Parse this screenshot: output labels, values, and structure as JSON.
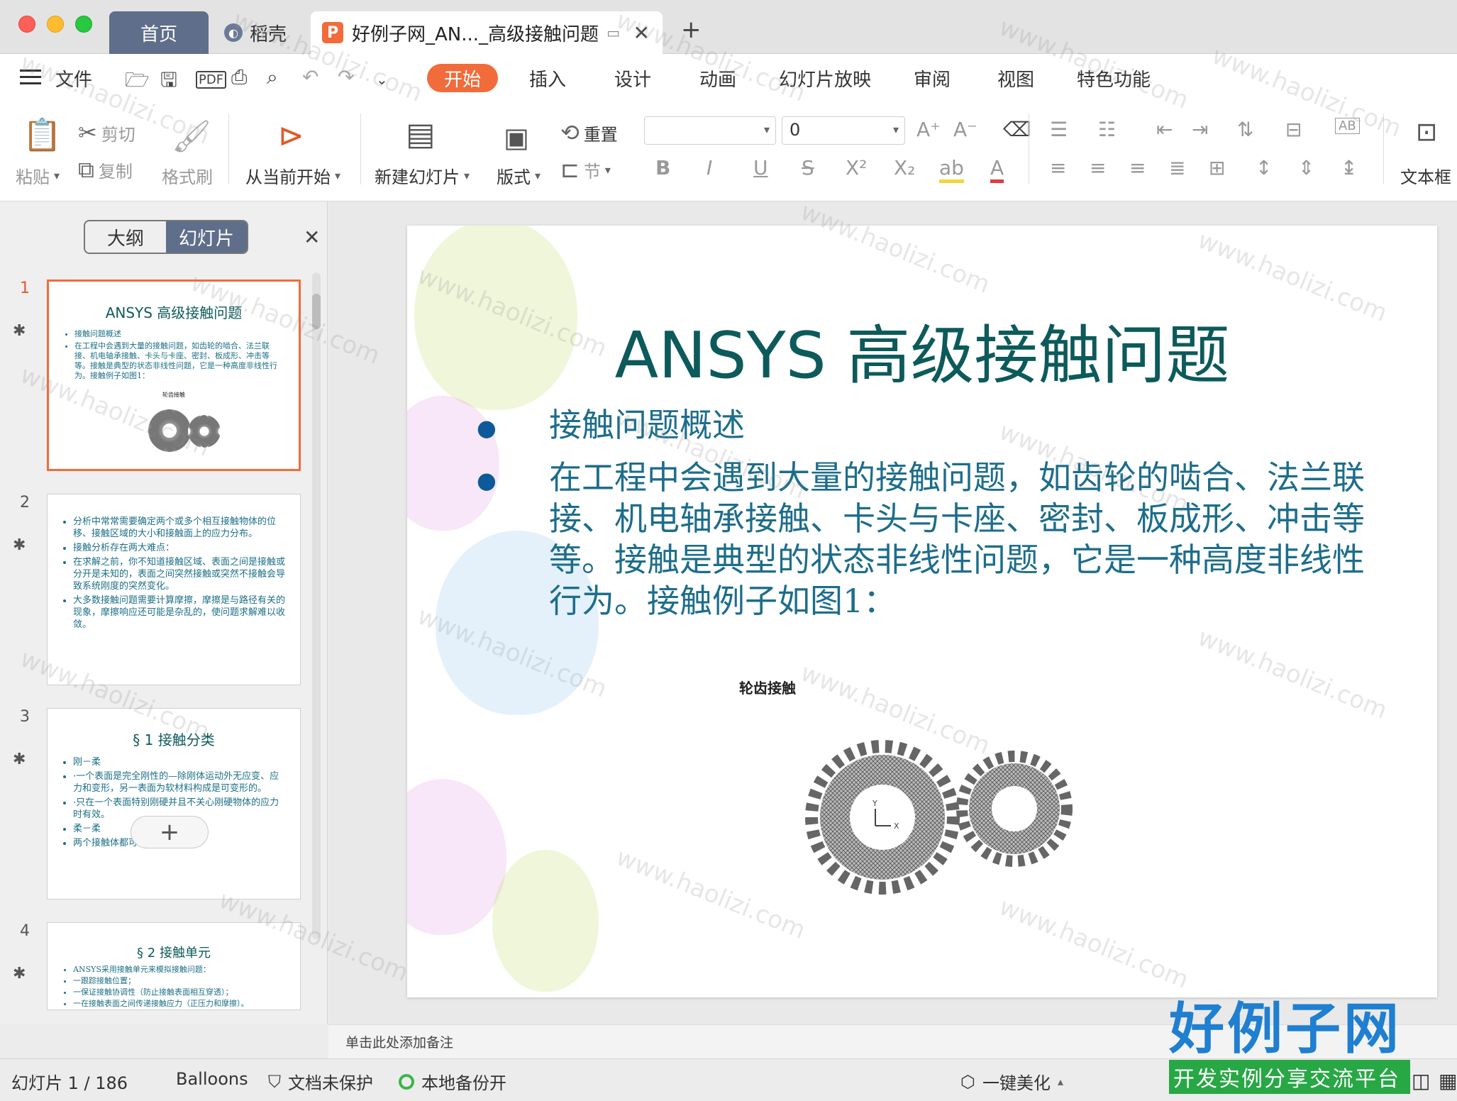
{
  "window": {
    "tabs": [
      {
        "label": "首页"
      },
      {
        "label": "稻壳"
      },
      {
        "label": "好例子网_AN..._高级接触问题"
      }
    ],
    "add_tab": "+"
  },
  "menubar": {
    "file_label": "文件",
    "ribbon_tabs": [
      "开始",
      "插入",
      "设计",
      "动画",
      "幻灯片放映",
      "审阅",
      "视图",
      "特色功能"
    ]
  },
  "toolbar": {
    "paste": "粘贴",
    "cut": "剪切",
    "copy": "复制",
    "format_painter": "格式刷",
    "play_from_current": "从当前开始",
    "new_slide": "新建幻灯片",
    "layout": "版式",
    "reset": "重置",
    "section": "节",
    "font_size": "0",
    "textbox": "文本框"
  },
  "panel": {
    "seg_outline": "大纲",
    "seg_slides": "幻灯片",
    "thumbs": [
      {
        "num": "1",
        "title": "ANSYS 高级接触问题",
        "bullets": [
          "接触问题概述",
          "在工程中会遇到大量的接触问题，如齿轮的啮合、法兰联接、机电轴承接触、卡头与卡座、密封、板成形、冲击等等。接触是典型的状态非线性问题，它是一种高度非线性行为。接触例子如图1："
        ],
        "caption": "轮齿接触"
      },
      {
        "num": "2",
        "bullets": [
          "分析中常常需要确定两个或多个相互接触物体的位移、接触区域的大小和接触面上的应力分布。",
          "接触分析存在两大难点：",
          "在求解之前，你不知道接触区域、表面之间是接触或分开是未知的，表面之间突然接触或突然不接触会导致系统刚度的突然变化。",
          "大多数接触问题需要计算摩擦，摩擦是与路径有关的现象，摩擦响应还可能是杂乱的，使问题求解难以收敛。"
        ]
      },
      {
        "num": "3",
        "title": "§ 1 接触分类",
        "bullets": [
          "刚－柔",
          "·一个表面是完全刚性的—除刚体运动外无应变、应力和变形，另一表面为软材料构成是可变形的。",
          "·只在一个表面特别刚硬并且不关心刚硬物体的应力时有效。",
          "柔－柔",
          "两个接触体都可以变形。"
        ]
      },
      {
        "num": "4",
        "title": "§ 2 接触单元",
        "bullets": [
          "ANSYS采用接触单元来模拟接触问题：",
          "一跟踪接触位置；",
          "一保证接触协调性（防止接触表面相互穿透）；",
          "一在接触表面之间传递接触应力（正压力和摩擦）。"
        ]
      }
    ]
  },
  "slide": {
    "title": "ANSYS 高级接触问题",
    "bullets": [
      "接触问题概述",
      "在工程中会遇到大量的接触问题，如齿轮的啮合、法兰联接、机电轴承接触、卡头与卡座、密封、板成形、冲击等等。接触是典型的状态非线性问题，它是一种高度非线性行为。接触例子如图1："
    ],
    "figure_caption": "轮齿接触",
    "axis_y": "Y",
    "axis_x": "X"
  },
  "notes_placeholder": "单击此处添加备注",
  "status": {
    "slide_counter": "幻灯片 1 / 186",
    "theme": "Balloons",
    "protection": "文档未保护",
    "backup": "本地备份开",
    "beautify": "一键美化"
  },
  "watermark": {
    "text": "www.haolizi.com",
    "logo_top": "好例子网",
    "logo_bottom": "开发实例分享交流平台"
  },
  "colors": {
    "accent": "#f26b3a",
    "title_teal": "#0d5a5b",
    "body_blue": "#1d6d8b",
    "tab_active": "#5f6e8a"
  }
}
